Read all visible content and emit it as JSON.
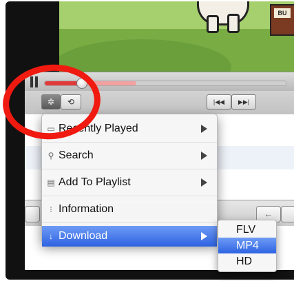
{
  "video": {
    "sign_text": "BU"
  },
  "player": {
    "progress": 0.15,
    "buffered": 0.38
  },
  "controls": {
    "gear_icon": "gear-icon",
    "repeat_icon": "repeat-icon",
    "prev_glyph": "|◀◀",
    "next_glyph": "▶▶|"
  },
  "menu": {
    "items": [
      {
        "label": "Recently Played",
        "icon": "monitor-icon",
        "glyph": "▭",
        "has_submenu": true
      },
      {
        "label": "Search",
        "icon": "search-icon",
        "glyph": "⚲",
        "has_submenu": true
      },
      {
        "label": "Add To Playlist",
        "icon": "document-icon",
        "glyph": "▤",
        "has_submenu": true
      },
      {
        "label": "Information",
        "icon": "info-icon",
        "glyph": "⁝",
        "has_submenu": false
      },
      {
        "label": "Download",
        "icon": "download-arrow-icon",
        "glyph": "↓",
        "has_submenu": true,
        "highlighted": true
      }
    ]
  },
  "submenu": {
    "items": [
      {
        "label": "FLV"
      },
      {
        "label": "MP4",
        "highlighted": true
      },
      {
        "label": "HD"
      }
    ]
  },
  "lower_bar": {
    "back_glyph": "←"
  },
  "colors": {
    "highlight": "#3d6fe6",
    "annotation": "#f01a10",
    "progress": "#e03a3a"
  }
}
